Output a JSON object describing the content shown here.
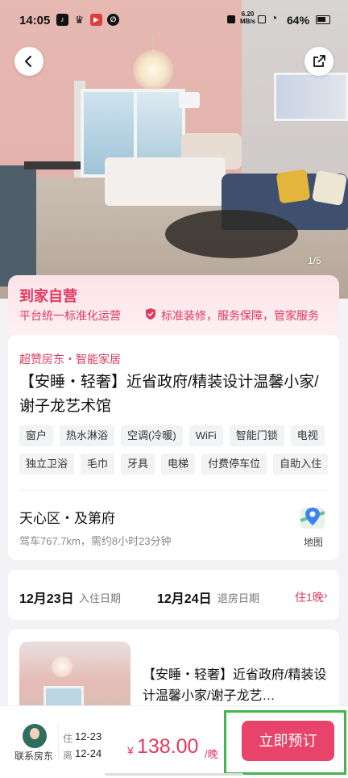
{
  "status_bar": {
    "time": "14:05",
    "net_speed": "6.20",
    "net_unit": "MB/s",
    "battery": "64%"
  },
  "hero": {
    "image_counter": "1/5"
  },
  "promo": {
    "title": "到家自营",
    "subtitle": "平台统一标准化运营",
    "guarantee": "标准装修，服务保障，管家服务"
  },
  "listing": {
    "tagline": "超赞房东・智能家居",
    "title": "【安睡・轻奢】近省政府/精装设计温馨小家/谢子龙艺术馆",
    "amenities": [
      "窗户",
      "热水淋浴",
      "空调(冷暖)",
      "WiFi",
      "智能门锁",
      "电视",
      "独立卫浴",
      "毛巾",
      "牙具",
      "电梯",
      "付费停车位",
      "自助入住"
    ],
    "location": "天心区・及第府",
    "drive_info": "驾车767.7km，需约8小时23分钟",
    "map_label": "地图"
  },
  "dates": {
    "check_in": "12月23日",
    "check_in_label": "入住日期",
    "check_out": "12月24日",
    "check_out_label": "退房日期",
    "nights": "住1晚"
  },
  "room": {
    "title": "【安睡・轻奢】近省政府/精装设计温馨小家/谢子龙艺…"
  },
  "bottom_bar": {
    "contact_label": "联系房东",
    "stay_in_label": "住",
    "stay_in": "12-23",
    "stay_out_label": "离",
    "stay_out": "12-24",
    "price_currency": "¥",
    "price": "138.00",
    "price_unit": "/晚",
    "book_label": "立即预订"
  },
  "colors": {
    "accent": "#e0395f",
    "book_button": "#e8436a"
  }
}
